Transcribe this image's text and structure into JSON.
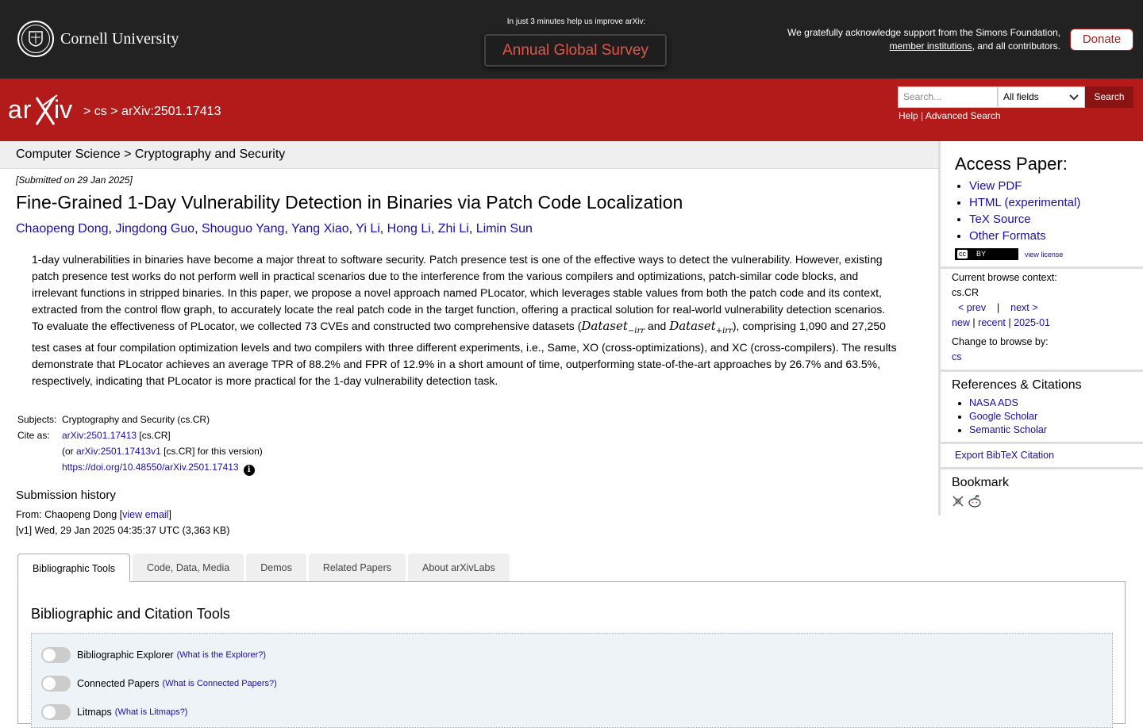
{
  "banner": {
    "institution": "Cornell University",
    "survey_note": "In just 3 minutes help us improve arXiv:",
    "survey_button": "Annual Global Survey",
    "support_line1": "We gratefully acknowledge support from the Simons Foundation,",
    "support_link": "member institutions",
    "support_line2_tail": ", and all contributors.",
    "donate": "Donate"
  },
  "header": {
    "logo_text": "arXiv",
    "breadcrumb_sep": ">",
    "breadcrumb_cs": "cs",
    "breadcrumb_id": "arXiv:2501.17413",
    "search_placeholder": "Search...",
    "search_field": "All fields",
    "search_button": "Search",
    "help": "Help",
    "advanced": "Advanced Search"
  },
  "subheader": "Computer Science > Cryptography and Security",
  "paper": {
    "submitted": "[Submitted on 29 Jan 2025]",
    "title": "Fine-Grained 1-Day Vulnerability Detection in Binaries via Patch Code Localization",
    "authors": [
      "Chaopeng Dong",
      "Jingdong Guo",
      "Shouguo Yang",
      "Yang Xiao",
      "Yi Li",
      "Hong Li",
      "Zhi Li",
      "Limin Sun"
    ],
    "abstract_p1": "1-day vulnerabilities in binaries have become a major threat to software security. Patch presence test is one of the effective ways to detect the vulnerability. However, existing patch presence test works do not perform well in practical scenarios due to the interference from the various compilers and optimizations, patch-similar code blocks, and irrelevant functions in stripped binaries. In this paper, we propose a novel approach named PLocator, which leverages stable values from both the patch code and its context, extracted from the control flow graph, to accurately locate the real patch code in the target function, offering a practical solution for real-world vulnerability detection scenarios.",
    "abstract_p2_a": "To evaluate the effectiveness of PLocator, we collected 73 CVEs and constructed two comprehensive datasets (",
    "math_1": "Dataset",
    "math_1_sub": "−irr",
    "abstract_p2_and": " and ",
    "math_2": "Dataset",
    "math_2_sub": "+irr",
    "abstract_p2_b": "), comprising 1,090 and 27,250 test cases at four compilation optimization levels and two compilers with three different experiments, i.e., Same, XO (cross-optimizations), and XC (cross-compilers). The results demonstrate that PLocator achieves an average TPR of 88.2% and FPR of 12.9% in a short amount of time, outperforming state-of-the-art approaches by 26.7% and 63.5%, respectively, indicating that PLocator is more practical for the 1-day vulnerability detection task.",
    "subjects_label": "Subjects:",
    "subjects": "Cryptography and Security (cs.CR)",
    "cite_label": "Cite as:",
    "cite_id": "arXiv:2501.17413",
    "cite_cat": " [cs.CR]",
    "cite_or": "(or ",
    "cite_v1": "arXiv:2501.17413v1",
    "cite_v1_tail": " [cs.CR] for this version)",
    "doi": "https://doi.org/10.48550/arXiv.2501.17413",
    "history_heading": "Submission history",
    "history_from": "From: Chaopeng Dong [",
    "history_email": "view email",
    "history_from_end": "]",
    "history_v1": "[v1] Wed, 29 Jan 2025 04:35:37 UTC (3,363 KB)"
  },
  "sidebar": {
    "access_heading": "Access Paper:",
    "access_links": [
      "View PDF",
      "HTML (experimental)",
      "TeX Source",
      "Other Formats"
    ],
    "license_badge": "cc",
    "license_by": "BY",
    "view_license": "view license",
    "browse_context_label": "Current browse context:",
    "browse_context": "cs.CR",
    "prev": "< prev",
    "sep": "|",
    "next": "next >",
    "new": "new",
    "recent": "recent",
    "month": "2025-01",
    "change_browse": "Change to browse by:",
    "browse_cs": "cs",
    "refs_heading": "References & Citations",
    "refs": [
      "NASA ADS",
      "Google Scholar",
      "Semantic Scholar"
    ],
    "export": "Export BibTeX Citation",
    "bookmark": "Bookmark"
  },
  "tabs": [
    "Bibliographic Tools",
    "Code, Data, Media",
    "Demos",
    "Related Papers",
    "About arXivLabs"
  ],
  "panel": {
    "heading": "Bibliographic and Citation Tools",
    "tools": [
      {
        "label": "Bibliographic Explorer",
        "link": "(What is the Explorer?)"
      },
      {
        "label": "Connected Papers",
        "link": "(What is Connected Papers?)"
      },
      {
        "label": "Litmaps",
        "link": "(What is Litmaps?)"
      }
    ]
  }
}
